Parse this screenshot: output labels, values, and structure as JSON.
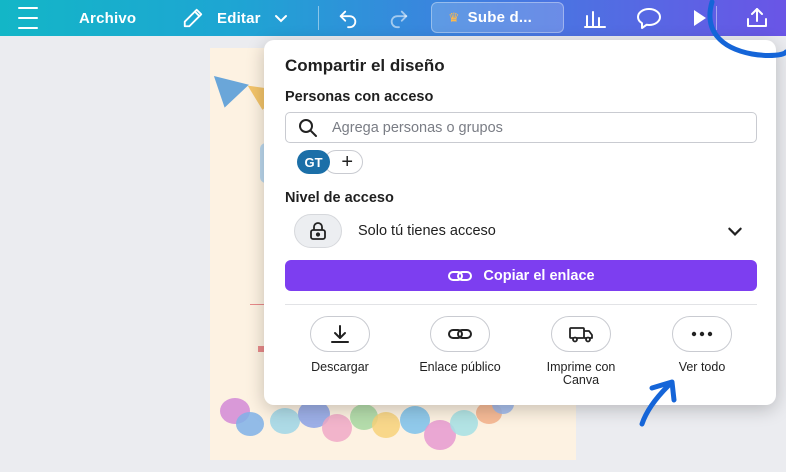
{
  "toolbar": {
    "menu_icon": "hamburger-icon",
    "archivo_label": "Archivo",
    "editar_label": "Editar",
    "sube_label": "Sube d...",
    "colors": {
      "gradient_start": "#13b6c7",
      "gradient_end": "#6a55e6"
    }
  },
  "share_panel": {
    "title": "Compartir el diseño",
    "people_label": "Personas con acceso",
    "search_placeholder": "Agrega personas o grupos",
    "avatar_initials": "GT",
    "access_level_label": "Nivel de acceso",
    "access_value": "Solo tú tienes acceso",
    "copy_link_label": "Copiar el enlace",
    "accent_color": "#7d3ef0",
    "actions": [
      {
        "label": "Descargar",
        "icon": "download-icon"
      },
      {
        "label": "Enlace público",
        "icon": "link-icon"
      },
      {
        "label": "Imprime con Canva",
        "icon": "truck-icon"
      },
      {
        "label": "Ver todo",
        "icon": "more-icon"
      }
    ]
  }
}
